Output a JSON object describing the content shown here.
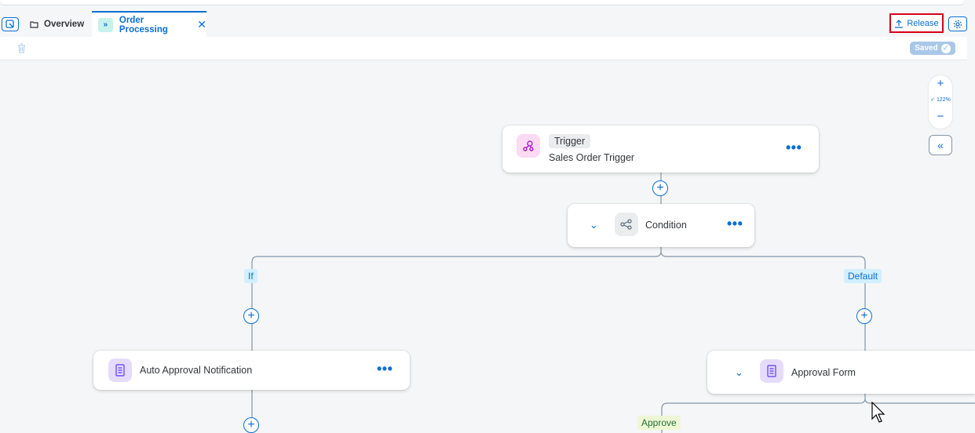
{
  "tabs": {
    "overview_label": "Overview",
    "active_label": "Order Processing",
    "active_badge": "»"
  },
  "toolbar": {
    "release_label": "Release",
    "saved_label": "Saved"
  },
  "zoom": {
    "plus": "+",
    "minus": "−",
    "level": "122%",
    "collapse": "«"
  },
  "nodes": {
    "trigger": {
      "tag": "Trigger",
      "name": "Sales Order Trigger",
      "more": "•••"
    },
    "condition": {
      "name": "Condition",
      "more": "•••"
    },
    "auto_approval": {
      "name": "Auto Approval Notification",
      "more": "•••"
    },
    "approval_form": {
      "name": "Approval Form"
    }
  },
  "branches": {
    "if_label": "If",
    "default_label": "Default",
    "approve_label": "Approve"
  },
  "colors": {
    "accent": "#0a6ed1",
    "release_highlight": "#d6001c"
  }
}
